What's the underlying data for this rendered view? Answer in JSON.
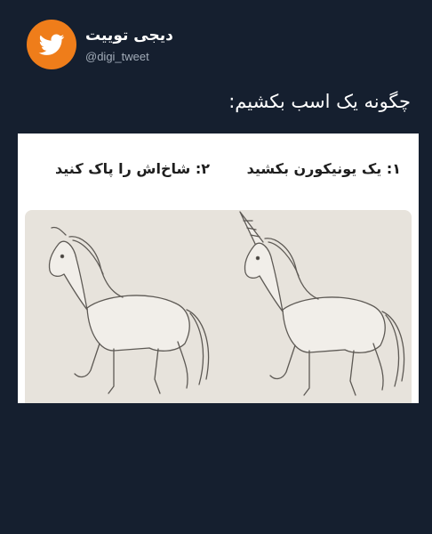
{
  "account": {
    "name": "دیجی توییت",
    "handle": "@digi_tweet",
    "avatar_icon": "bird-icon",
    "avatar_color": "#ef7d1a"
  },
  "tweet": {
    "text": "چگونه یک اسب بکشیم:"
  },
  "media": {
    "step1_label": "۱: یک یونیکورن بکشید",
    "step2_label": "۲: شاخ‌اش را پاک کنید",
    "step1_image": "unicorn-sketch",
    "step2_image": "horse-sketch"
  },
  "colors": {
    "background": "#151f2f",
    "text": "#ffffff",
    "handle": "#a2acb8",
    "panel_bg": "#e7e3dc"
  }
}
